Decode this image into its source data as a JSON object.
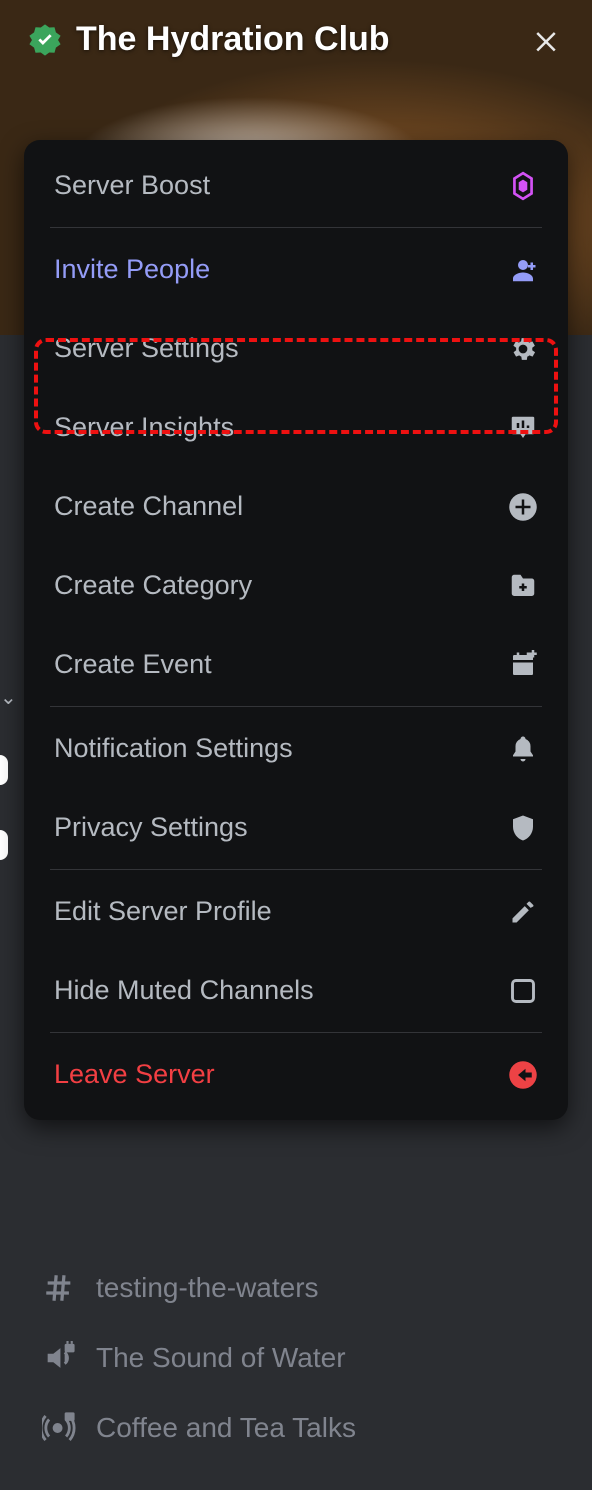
{
  "server": {
    "name": "The Hydration Club"
  },
  "menu": {
    "boost": "Server Boost",
    "invite": "Invite People",
    "settings": "Server Settings",
    "insights": "Server Insights",
    "create_channel": "Create Channel",
    "create_category": "Create Category",
    "create_event": "Create Event",
    "notifications": "Notification Settings",
    "privacy": "Privacy Settings",
    "edit_profile": "Edit Server Profile",
    "hide_muted": "Hide Muted Channels",
    "leave": "Leave Server"
  },
  "channels": [
    {
      "name": "testing-the-waters",
      "type": "text"
    },
    {
      "name": "The Sound of Water",
      "type": "voice-locked"
    },
    {
      "name": "Coffee and Tea Talks",
      "type": "stage-locked"
    }
  ],
  "colors": {
    "accent_invite": "#949cf7",
    "danger": "#f23f43",
    "boost": "#d352f5",
    "text_muted": "#80848e",
    "text_normal": "#b5bac1"
  }
}
